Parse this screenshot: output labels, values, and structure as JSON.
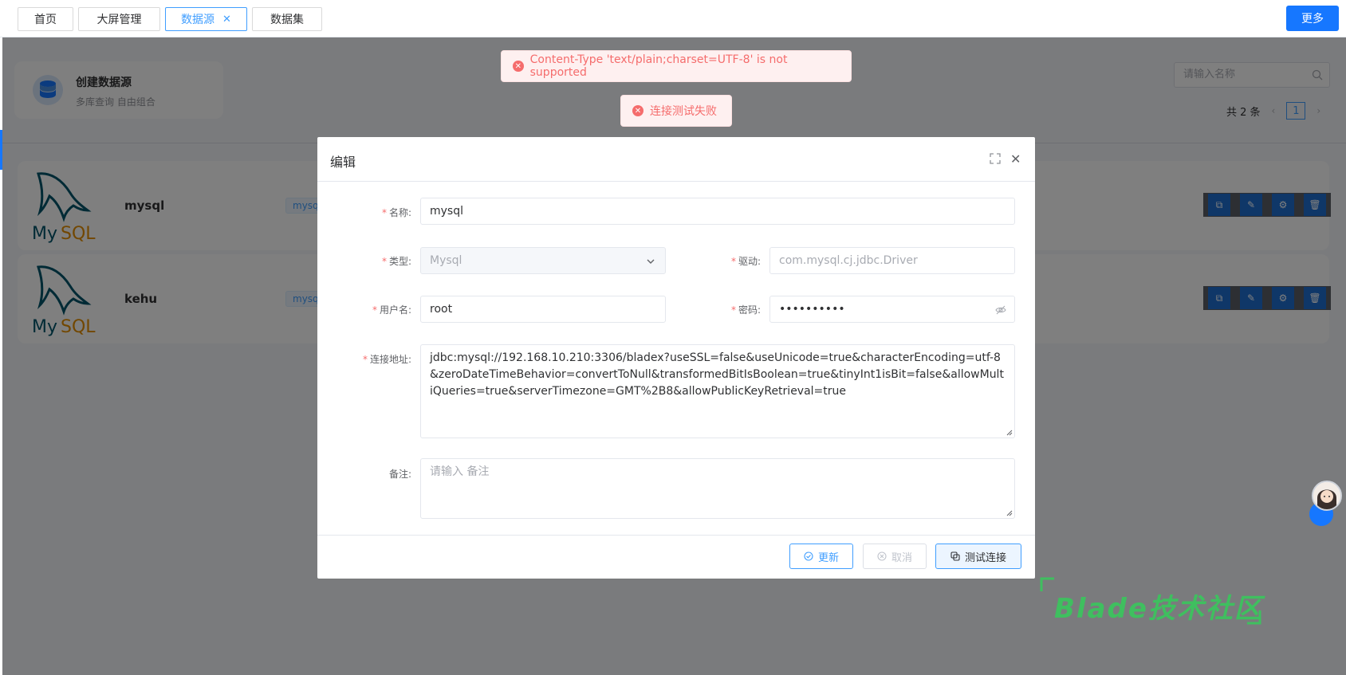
{
  "tabs": [
    {
      "label": "首页"
    },
    {
      "label": "大屏管理"
    },
    {
      "label": "数据源",
      "active": true,
      "closable": true
    },
    {
      "label": "数据集"
    }
  ],
  "more_label": "更多",
  "create_card": {
    "title": "创建数据源",
    "subtitle": "多库查询 自由组合"
  },
  "search": {
    "placeholder": "请输入名称"
  },
  "pagination": {
    "total_text": "共 2 条",
    "current_page": "1"
  },
  "datasources": [
    {
      "name": "mysql",
      "tag": "mysq",
      "logo_text": "MySQL"
    },
    {
      "name": "kehu",
      "tag": "mysq",
      "logo_text": "MySQL"
    }
  ],
  "toasts": [
    {
      "message": "Content-Type 'text/plain;charset=UTF-8' is not supported"
    },
    {
      "message": "连接测试失败"
    }
  ],
  "dialog": {
    "title": "编辑",
    "fields": {
      "name": {
        "label": "名称:",
        "value": "mysql"
      },
      "type": {
        "label": "类型:",
        "value": "Mysql"
      },
      "driver": {
        "label": "驱动:",
        "value": "com.mysql.cj.jdbc.Driver"
      },
      "username": {
        "label": "用户名:",
        "value": "root"
      },
      "password": {
        "label": "密码:",
        "value": "••••••••••"
      },
      "url": {
        "label": "连接地址:",
        "value": "jdbc:mysql://192.168.10.210:3306/bladex?useSSL=false&useUnicode=true&characterEncoding=utf-8&zeroDateTimeBehavior=convertToNull&transformedBitIsBoolean=true&tinyInt1isBit=false&allowMultiQueries=true&serverTimezone=GMT%2B8&allowPublicKeyRetrieval=true"
      },
      "remark": {
        "label": "备注:",
        "placeholder": "请输入 备注"
      }
    },
    "buttons": {
      "update": "更新",
      "cancel": "取消",
      "test": "测试连接"
    }
  },
  "watermark": "Blade技术社区",
  "colors": {
    "primary": "#1677ff",
    "error": "#f56c6c",
    "watermark": "#3fbf5f"
  }
}
